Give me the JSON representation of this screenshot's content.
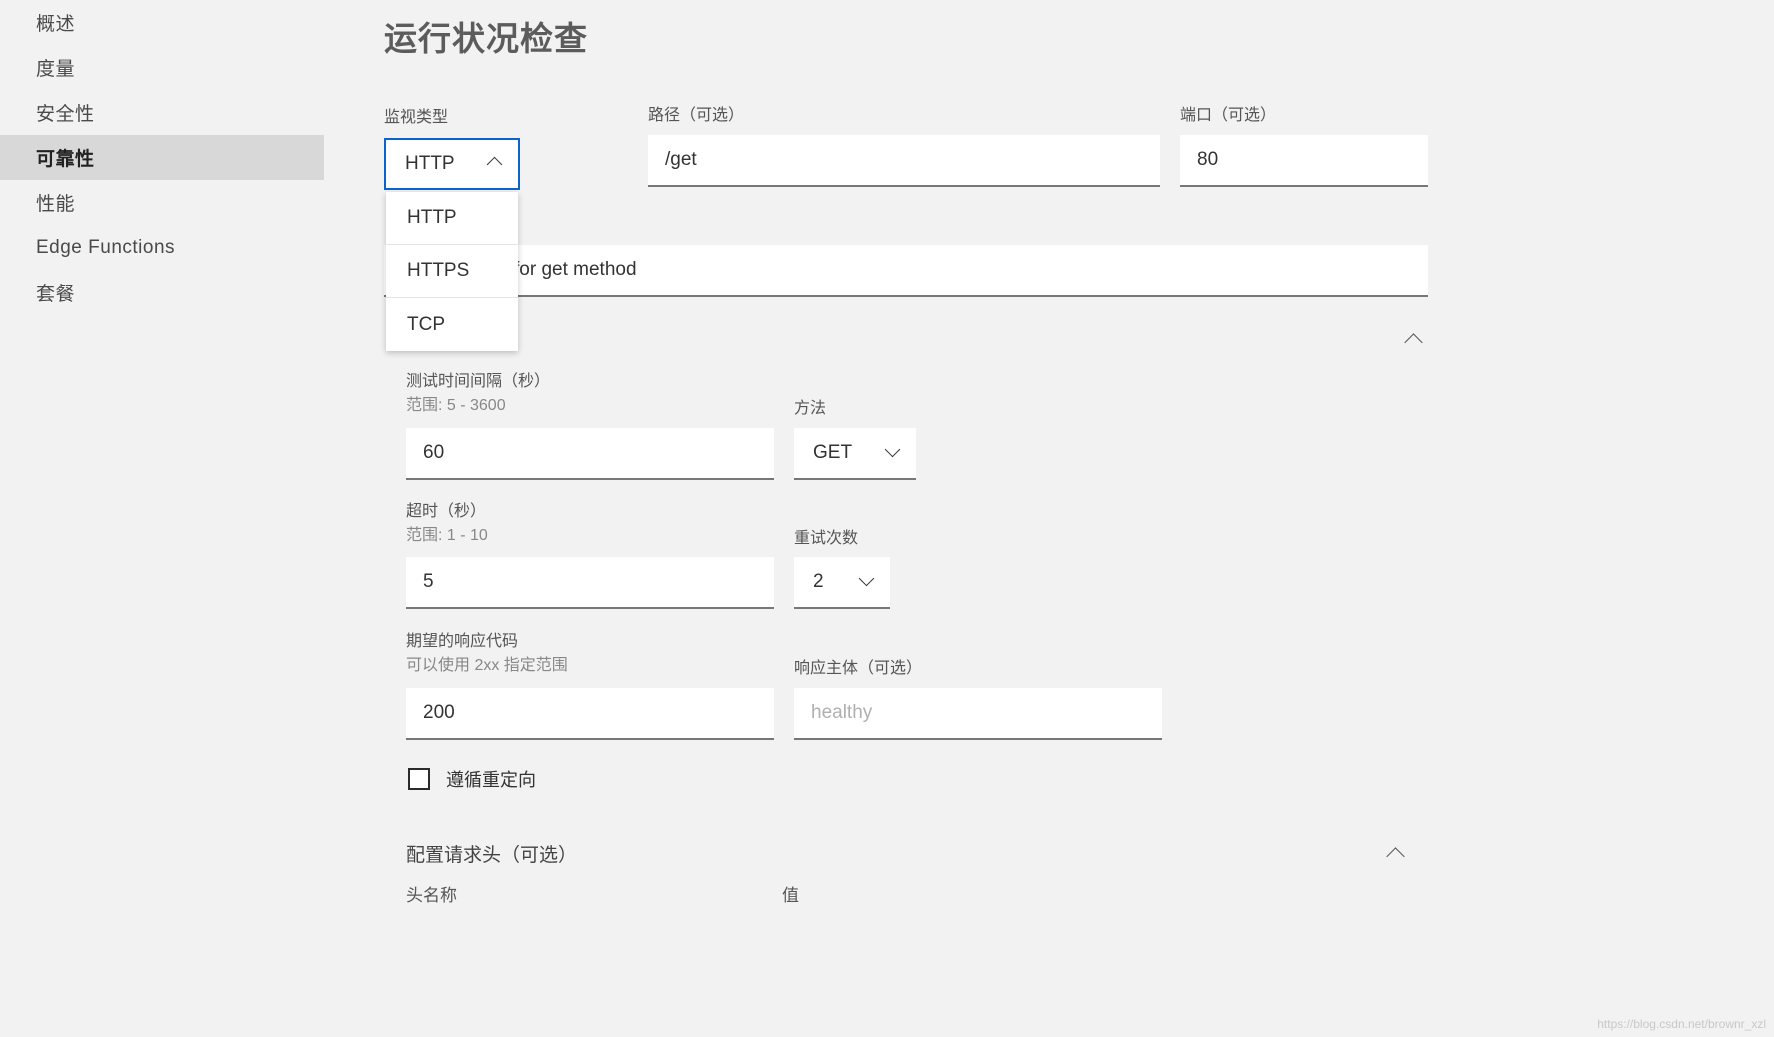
{
  "sidebar": {
    "items": [
      {
        "label": "概述",
        "active": false
      },
      {
        "label": "度量",
        "active": false
      },
      {
        "label": "安全性",
        "active": false
      },
      {
        "label": "可靠性",
        "active": true
      },
      {
        "label": "性能",
        "active": false
      },
      {
        "label": "Edge Functions",
        "active": false
      },
      {
        "label": "套餐",
        "active": false
      }
    ]
  },
  "main": {
    "title": "运行状况检查",
    "monitor_type": {
      "label": "监视类型",
      "value": "HTTP",
      "expanded": true,
      "options": [
        "HTTP",
        "HTTPS",
        "TCP"
      ]
    },
    "path": {
      "label": "路径（可选）",
      "value": "/get"
    },
    "port": {
      "label": "端口（可选）",
      "value": "80"
    },
    "description_field": {
      "value": "for get method"
    },
    "interval": {
      "label": "测试时间间隔（秒）",
      "sub": "范围: 5 - 3600",
      "value": "60"
    },
    "method": {
      "label": "方法",
      "value": "GET"
    },
    "timeout": {
      "label": "超时（秒）",
      "sub": "范围: 1 - 10",
      "value": "5"
    },
    "retries": {
      "label": "重试次数",
      "value": "2"
    },
    "expected_code": {
      "label": "期望的响应代码",
      "sub": "可以使用 2xx 指定范围",
      "value": "200"
    },
    "response_body": {
      "label": "响应主体（可选）",
      "placeholder": "healthy"
    },
    "follow_redirect": {
      "label": "遵循重定向",
      "checked": false
    },
    "headers_section": {
      "title": "配置请求头（可选）",
      "col_name": "头名称",
      "col_value": "值"
    }
  },
  "watermark": "https://blog.csdn.net/brownr_xzl",
  "colors": {
    "focus": "#0b63ce",
    "active_bg": "#d8d8d8",
    "page_bg": "#f2f2f2"
  }
}
